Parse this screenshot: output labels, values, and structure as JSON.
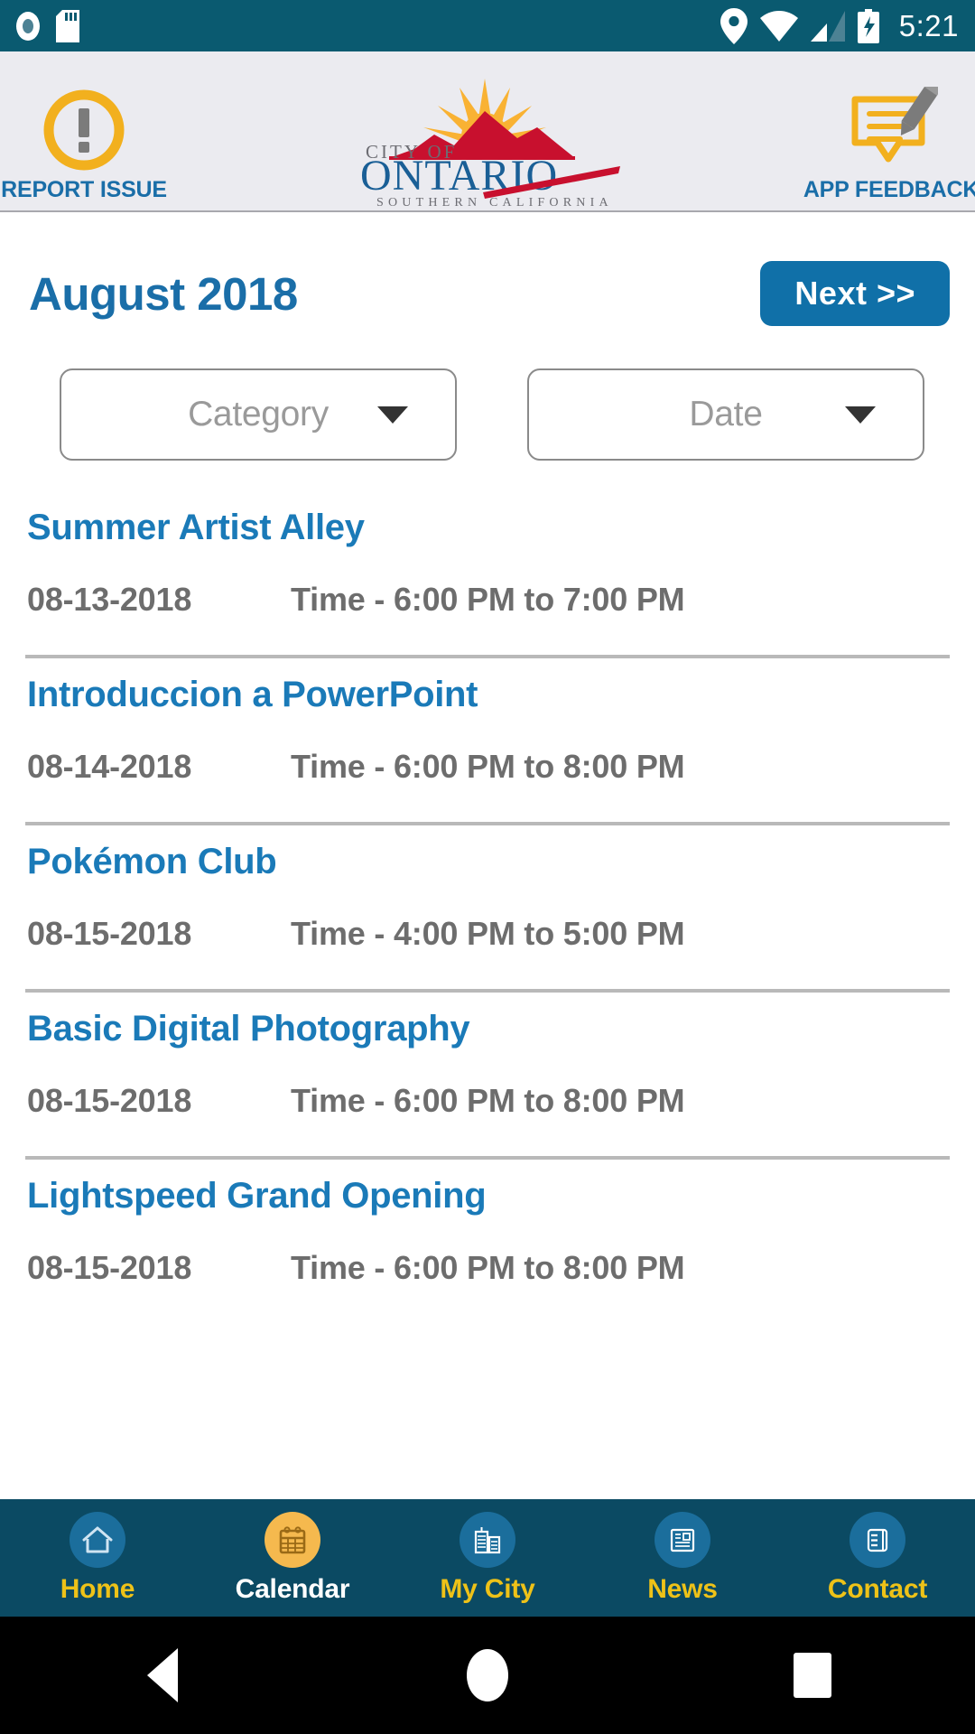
{
  "status_bar": {
    "time": "5:21",
    "icons": [
      "record-icon",
      "sd-card-icon",
      "location-pin-icon",
      "wifi-icon",
      "cell-signal-icon",
      "battery-charging-icon"
    ],
    "background": "#0a5a70"
  },
  "app_header": {
    "left_button": {
      "label": "REPORT ISSUE",
      "icon": "alert-exclamation-icon"
    },
    "right_button": {
      "label": "APP FEEDBACK",
      "icon": "feedback-pencil-icon"
    },
    "logo": {
      "line1": "CITY OF",
      "line2": "ONTARIO",
      "line3": "SOUTHERN CALIFORNIA",
      "sun_color": "#f9b233",
      "mountain_color": "#c8102e",
      "text_color": "#1a5f96"
    },
    "background": "#ebebf0",
    "accent": "#1a6ea8"
  },
  "month_bar": {
    "title": "August 2018",
    "next_label": "Next >>",
    "accent": "#1070a8"
  },
  "filters": [
    {
      "name": "category",
      "placeholder": "Category"
    },
    {
      "name": "date",
      "placeholder": "Date"
    }
  ],
  "events": [
    {
      "title": "Summer Artist Alley",
      "date": "08-13-2018",
      "time": "Time - 6:00 PM to 7:00 PM"
    },
    {
      "title": "Introduccion a PowerPoint",
      "date": "08-14-2018",
      "time": "Time - 6:00 PM to 8:00 PM"
    },
    {
      "title": "Pokémon Club",
      "date": "08-15-2018",
      "time": "Time - 4:00 PM to 5:00 PM"
    },
    {
      "title": "Basic Digital Photography",
      "date": "08-15-2018",
      "time": "Time - 6:00 PM to 8:00 PM"
    },
    {
      "title": "Lightspeed Grand Opening",
      "date": "08-15-2018",
      "time": "Time - 6:00 PM to 8:00 PM"
    }
  ],
  "bottom_nav": {
    "background": "#0b4a63",
    "inactive_label_color": "#eec218",
    "active_label_color": "#ffffff",
    "active_circle_color": "#f5b94e",
    "items": [
      {
        "label": "Home",
        "icon": "home-icon",
        "active": false
      },
      {
        "label": "Calendar",
        "icon": "calendar-icon",
        "active": true
      },
      {
        "label": "My City",
        "icon": "buildings-icon",
        "active": false
      },
      {
        "label": "News",
        "icon": "newspaper-icon",
        "active": false
      },
      {
        "label": "Contact",
        "icon": "contact-book-icon",
        "active": false
      }
    ]
  },
  "android_nav": {
    "back": "back-triangle-icon",
    "home": "home-circle-icon",
    "recents": "recents-square-icon"
  }
}
